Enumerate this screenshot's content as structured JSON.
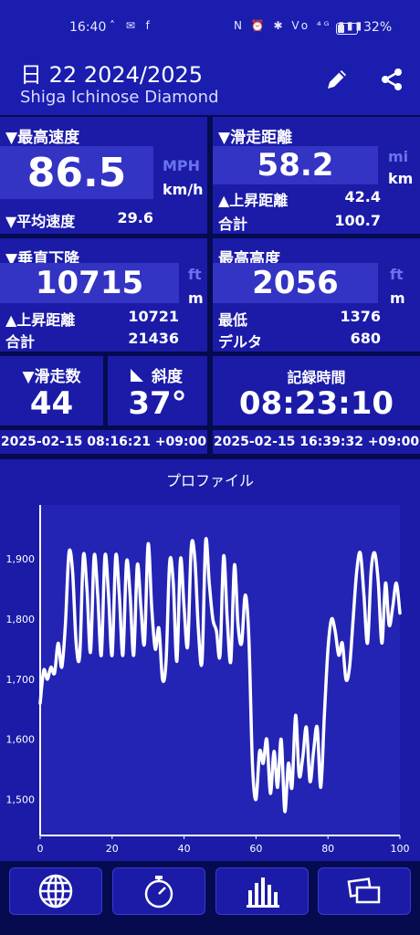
{
  "status_bar": {
    "time": "16:40",
    "left_icons": "˄ ✉ f",
    "right_icons": "N ⏰ ✱ Vo ⁴ᴳ ▮▮▮",
    "battery_percent": "32%"
  },
  "header": {
    "title": "日 22 2024/2025",
    "subtitle": "Shiga Ichinose Diamond",
    "edit_icon": "pencil-icon",
    "share_icon": "share-icon"
  },
  "max_speed": {
    "label": "▼最高速度",
    "value": "86.5",
    "unit_alt": "MPH",
    "unit": "km/h",
    "avg_label": "▼平均速度",
    "avg_value": "29.6"
  },
  "ski_distance": {
    "label": "▼滑走距離",
    "value": "58.2",
    "unit_alt": "mi",
    "unit": "km",
    "ascent_label": "▲上昇距離",
    "ascent_value": "42.4",
    "total_label": "合計",
    "total_value": "100.7"
  },
  "vertical_descent": {
    "label": "▼垂直下降",
    "value": "10715",
    "unit_alt": "ft",
    "unit": "m",
    "ascent_label": "▲上昇距離",
    "ascent_value": "10721",
    "total_label": "合計",
    "total_value": "21436"
  },
  "max_altitude": {
    "label": "最高高度",
    "value": "2056",
    "unit_alt": "ft",
    "unit": "m",
    "min_label": "最低",
    "min_value": "1376",
    "delta_label": "デルタ",
    "delta_value": "680"
  },
  "runs": {
    "label": "▼滑走数",
    "value": "44"
  },
  "slope": {
    "label": "斜度",
    "value": "37°"
  },
  "record_time": {
    "label": "記録時間",
    "value": "08:23:10"
  },
  "timestamps": {
    "start": "2025-02-15 08:16:21 +09:00",
    "end": "2025-02-15 16:39:32 +09:00"
  },
  "profile": {
    "title": "プロファイル"
  },
  "chart_data": {
    "type": "line",
    "title": "プロファイル",
    "xlabel": "",
    "ylabel": "",
    "xlim": [
      0,
      100
    ],
    "ylim": [
      1440,
      1990
    ],
    "x_ticks": [
      "0",
      "20",
      "40",
      "60",
      "80",
      "100"
    ],
    "y_ticks": [
      "1,500",
      "1,600",
      "1,700",
      "1,800",
      "1,900"
    ],
    "series": [
      {
        "name": "",
        "x": [
          0,
          1,
          2,
          3,
          4,
          5,
          6,
          7,
          8,
          9,
          10,
          11,
          12,
          13,
          14,
          15,
          16,
          17,
          18,
          19,
          20,
          21,
          22,
          23,
          24,
          25,
          26,
          27,
          28,
          29,
          30,
          31,
          32,
          33,
          34,
          35,
          36,
          37,
          38,
          39,
          40,
          41,
          42,
          43,
          44,
          45,
          46,
          47,
          48,
          49,
          50,
          51,
          52,
          53,
          54,
          55,
          56,
          57,
          58,
          59,
          60,
          61,
          62,
          63,
          64,
          65,
          66,
          67,
          68,
          69,
          70,
          71,
          72,
          73,
          74,
          75,
          76,
          77,
          78,
          79,
          80,
          81,
          82,
          83,
          84,
          85,
          86,
          87,
          88,
          89,
          90,
          91,
          92,
          93,
          94,
          95,
          96,
          97,
          98,
          99,
          100
        ],
        "values": [
          1660,
          1715,
          1700,
          1720,
          1710,
          1760,
          1720,
          1790,
          1910,
          1880,
          1760,
          1740,
          1905,
          1850,
          1745,
          1905,
          1840,
          1740,
          1905,
          1840,
          1740,
          1905,
          1840,
          1740,
          1895,
          1840,
          1740,
          1890,
          1820,
          1760,
          1925,
          1820,
          1750,
          1785,
          1700,
          1730,
          1895,
          1860,
          1730,
          1900,
          1820,
          1755,
          1920,
          1900,
          1780,
          1730,
          1930,
          1860,
          1800,
          1780,
          1740,
          1905,
          1800,
          1730,
          1890,
          1790,
          1760,
          1840,
          1770,
          1560,
          1500,
          1580,
          1560,
          1600,
          1510,
          1580,
          1520,
          1600,
          1480,
          1560,
          1520,
          1640,
          1540,
          1570,
          1620,
          1530,
          1580,
          1620,
          1520,
          1640,
          1750,
          1800,
          1780,
          1740,
          1760,
          1700,
          1720,
          1800,
          1880,
          1910,
          1840,
          1760,
          1880,
          1910,
          1860,
          1760,
          1860,
          1790,
          1820,
          1860,
          1810
        ]
      }
    ],
    "line_color": "#ffffff",
    "grid": false
  },
  "bottom_nav": [
    {
      "name": "map",
      "icon": "globe-icon"
    },
    {
      "name": "stopwatch",
      "icon": "stopwatch-icon"
    },
    {
      "name": "stats",
      "icon": "bar-chart-icon"
    },
    {
      "name": "photos",
      "icon": "gallery-icon"
    }
  ],
  "colors": {
    "app_background": "#050b4e",
    "card_background": "#1b1ba8",
    "value_box": "#3333c4",
    "header_background": "#1a1dae",
    "dim_unit": "#6a73ee"
  }
}
